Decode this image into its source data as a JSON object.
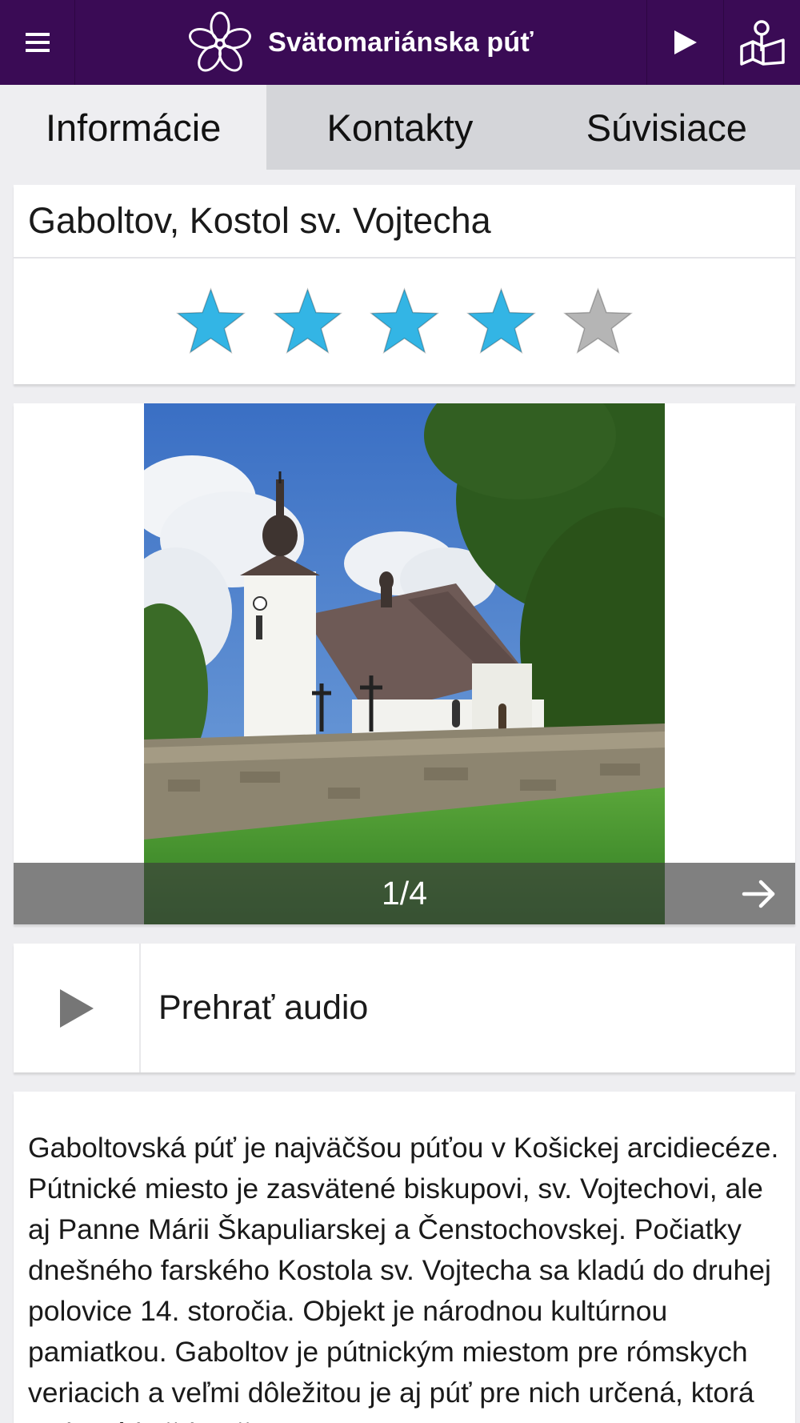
{
  "header": {
    "app_title": "Svätomariánska púť",
    "menu_icon": "hamburger-menu-icon",
    "play_icon": "play-icon",
    "map_icon": "map-pin-icon",
    "color": "#3a0b55"
  },
  "tabs": [
    {
      "label": "Informácie",
      "active": true
    },
    {
      "label": "Kontakty",
      "active": false
    },
    {
      "label": "Súvisiace",
      "active": false
    }
  ],
  "place": {
    "name": "Gaboltov, Kostol sv. Vojtecha",
    "rating": 4,
    "rating_max": 5,
    "star_color": "#33b5e5",
    "star_empty_color": "#b5b5b5"
  },
  "gallery": {
    "counter": "1/4",
    "next_icon": "arrow-right-icon"
  },
  "audio": {
    "label": "Prehrať audio",
    "icon": "play-icon"
  },
  "description": {
    "text": "Gaboltovská púť je najväčšou púťou v Košickej arcidiecéze. Pútnické miesto je zasvätené biskupovi, sv. Vojtechovi, ale aj Panne Márii Škapuliarskej a Čenstochovskej. Počiatky dnešného farského Kostola sv. Vojtecha sa kladú do druhej polovice 14. storočia. Objekt je národnou kultúrnou pamiatkou. Gaboltov je pútnickým miestom pre rómskych veriacich a veľmi dôležitou je aj púť pre nich určená, ktorá sa koná každoročne."
  }
}
